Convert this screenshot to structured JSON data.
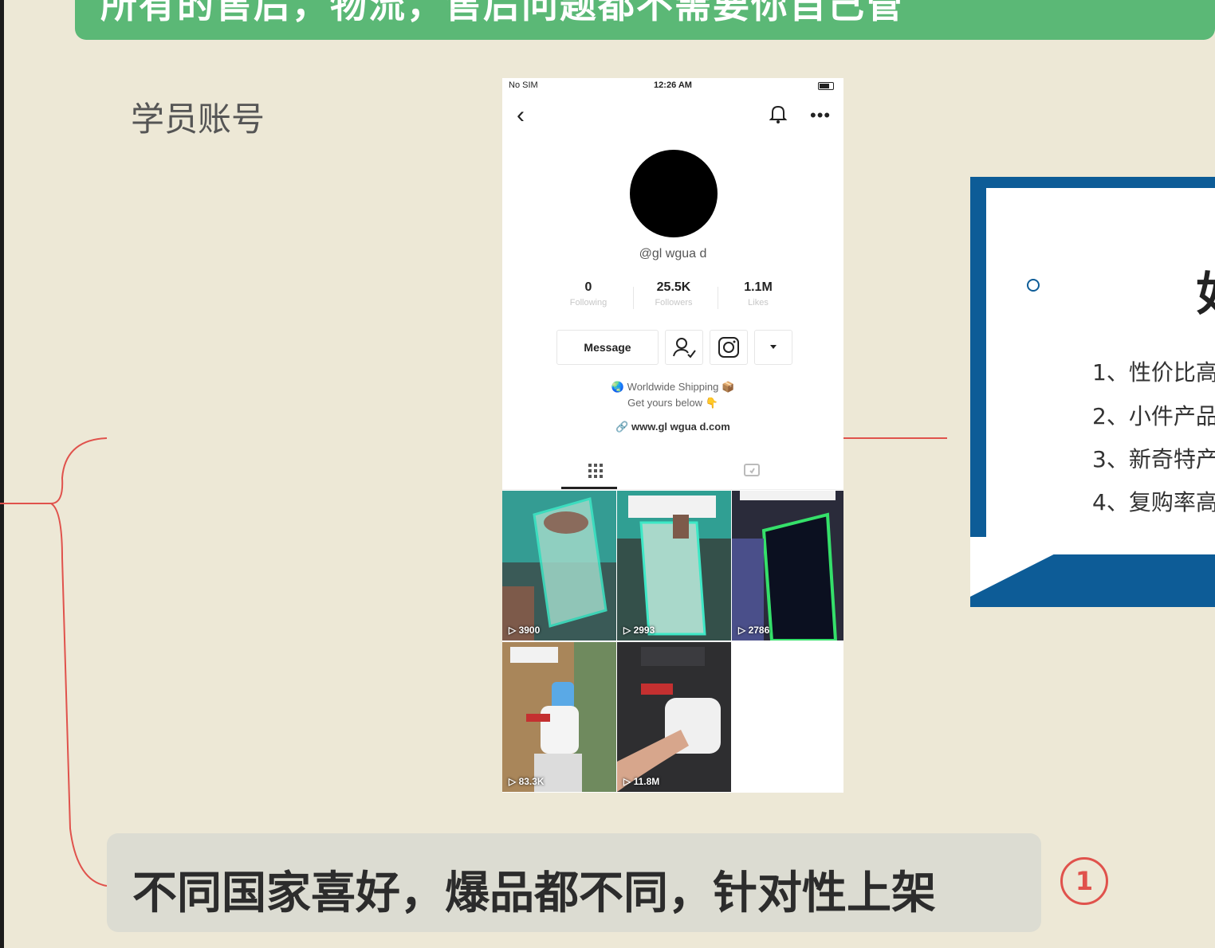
{
  "banner": {
    "text": "所有的售后，物流，售后问题都不需要你自己管"
  },
  "section_label": "学员账号",
  "phone": {
    "status": {
      "carrier": "No SIM",
      "time": "12:26 AM"
    },
    "username": "@gl  wgua d",
    "stats": [
      {
        "value": "0",
        "label": "Following"
      },
      {
        "value": "25.5K",
        "label": "Followers"
      },
      {
        "value": "1.1M",
        "label": "Likes"
      }
    ],
    "message_button": "Message",
    "bio_line1": "Worldwide Shipping",
    "bio_line2": "Get yours below",
    "link": "www.gl  wgua d.com",
    "videos": [
      {
        "views": "3900"
      },
      {
        "views": "2993"
      },
      {
        "views": "2786"
      },
      {
        "views": "83.3K"
      },
      {
        "views": "11.8M"
      }
    ]
  },
  "card": {
    "title_fragment": "如",
    "items": [
      "1、性价比高",
      "2、小件产品",
      "3、新奇特产",
      "4、复购率高"
    ]
  },
  "caption": "不同国家喜好，爆品都不同，针对性上架",
  "badge": "1",
  "colors": {
    "background": "#ede8d6",
    "banner_green": "#5bb876",
    "connector_red": "#e0524c",
    "card_blue": "#0d5c97"
  }
}
